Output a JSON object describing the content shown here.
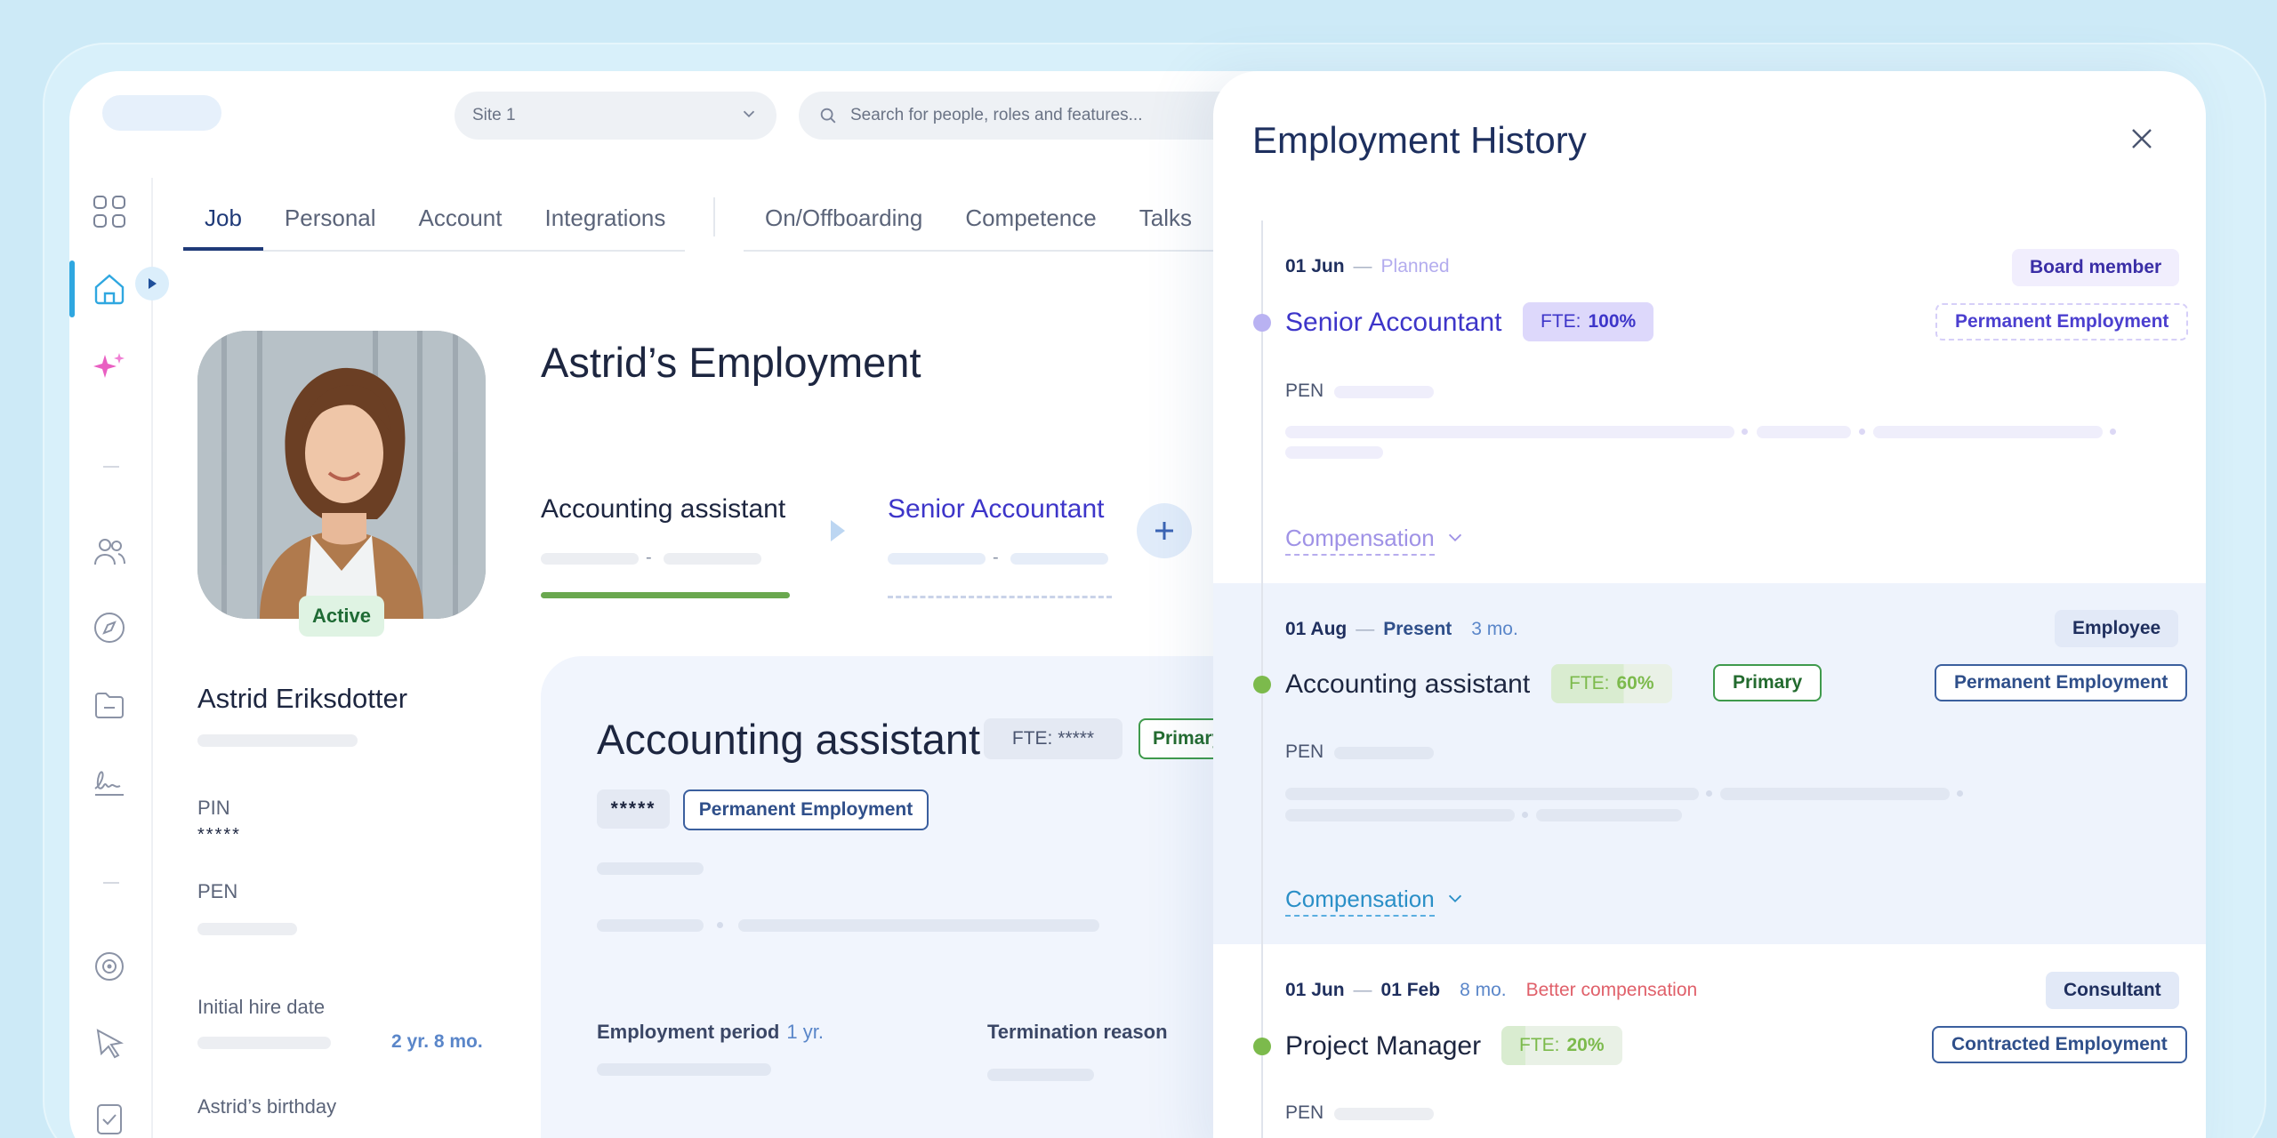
{
  "topbar": {
    "site_select": "Site 1",
    "search_placeholder": "Search for people, roles and features..."
  },
  "tabs": [
    "Job",
    "Personal",
    "Account",
    "Integrations"
  ],
  "tabs2": [
    "On/Offboarding",
    "Competence",
    "Talks"
  ],
  "profile": {
    "status": "Active",
    "name": "Astrid Eriksdotter",
    "pin_label": "PIN",
    "pin_value": "*****",
    "pen_label": "PEN",
    "hire_label": "Initial hire date",
    "hire_duration": "2 yr. 8 mo.",
    "birthday_label": "Astrid’s birthday"
  },
  "employment": {
    "title": "Astrid’s Employment",
    "role_current": "Accounting assistant",
    "role_next": "Senior Accountant",
    "range_sep": "-"
  },
  "job_card": {
    "title": "Accounting assistant",
    "fte_label": "FTE: *****",
    "primary_label": "Primary",
    "stars": "*****",
    "employment_type": "Permanent Employment",
    "period_label": "Employment period",
    "period_value": "1 yr.",
    "termination_label": "Termination reason"
  },
  "history": {
    "title": "Employment History",
    "entries": [
      {
        "date_start": "01 Jun",
        "date_sep": "—",
        "status": "Planned",
        "role": "Senior Accountant",
        "fte_label": "FTE:",
        "fte_value": "100%",
        "badge": "Board member",
        "employment_type": "Permanent Employment",
        "pen_label": "PEN",
        "compensation": "Compensation"
      },
      {
        "date_start": "01 Aug",
        "date_sep": "—",
        "date_end": "Present",
        "duration": "3 mo.",
        "role": "Accounting assistant",
        "fte_label": "FTE:",
        "fte_value": "60%",
        "primary": "Primary",
        "badge": "Employee",
        "employment_type": "Permanent Employment",
        "pen_label": "PEN",
        "compensation": "Compensation"
      },
      {
        "date_start": "01 Jun",
        "date_sep": "—",
        "date_end": "01 Feb",
        "duration": "8 mo.",
        "reason": "Better compensation",
        "role": "Project Manager",
        "fte_label": "FTE:",
        "fte_value": "20%",
        "badge": "Consultant",
        "employment_type": "Contracted Employment",
        "pen_label": "PEN"
      }
    ]
  },
  "colors": {
    "accent_blue": "#1f3a78",
    "planned_purple": "#3d35c9",
    "active_green": "#6aa84f",
    "reason_red": "#e0606a",
    "rail_active": "#2fa7e0"
  },
  "icons": [
    "apps-grid-icon",
    "home-icon",
    "sparkle-icon",
    "users-icon",
    "compass-icon",
    "folder-icon",
    "signature-icon",
    "target-icon",
    "pointer-icon",
    "checklist-icon",
    "search-icon",
    "chevron-down-icon",
    "close-icon",
    "play-icon",
    "plus-icon"
  ]
}
